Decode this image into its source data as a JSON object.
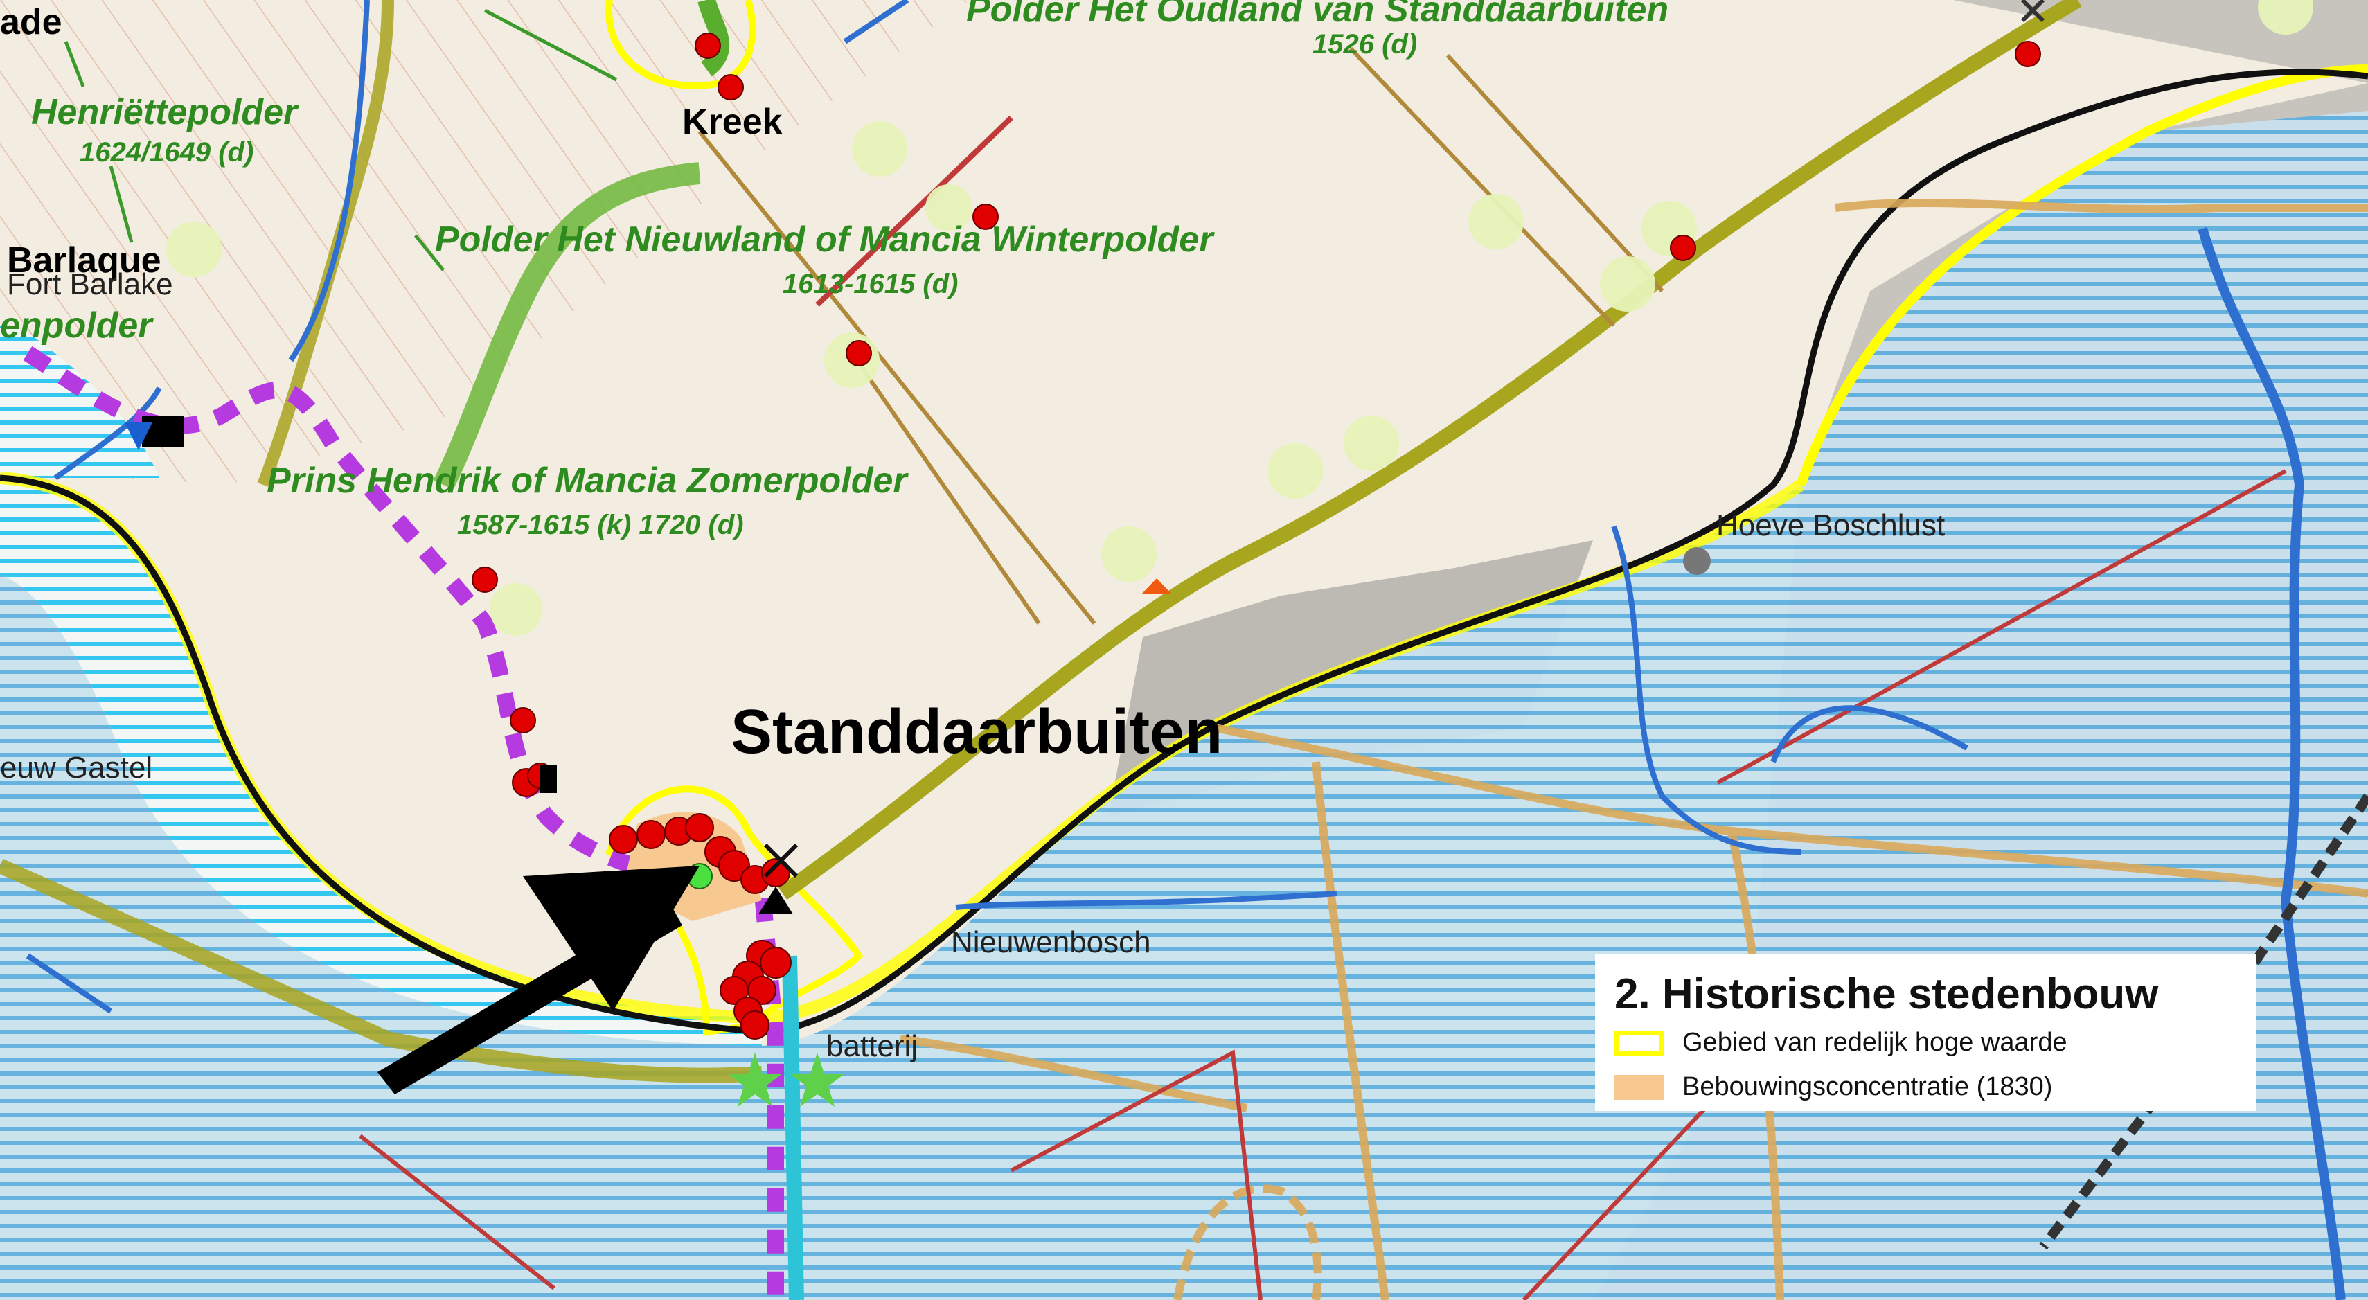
{
  "labels": {
    "polder_oudland": "Polder Het Oudland van Standdaarbuiten",
    "polder_oudland_date": "1526 (d)",
    "henriettepolder": "Henriëttepolder",
    "henriettepolder_date": "1624/1649 (d)",
    "kreek": "Kreek",
    "polder_nieuwland": "Polder Het Nieuwland of Mancia Winterpolder",
    "polder_nieuwland_date": "1613-1615 (d)",
    "barlaque": "Barlaque",
    "fort_barlake": "Fort Barlake",
    "enpolder": "enpolder",
    "ade": "ade",
    "prins_hendrik": "Prins Hendrik of Mancia Zomerpolder",
    "prins_hendrik_date": "1587-1615 (k) 1720 (d)",
    "hoeve_boschlust": "Hoeve Boschlust",
    "standdaarbuiten": "Standdaarbuiten",
    "euw_gastel": "euw Gastel",
    "nieuwenbosch": "Nieuwenbosch",
    "batterij": "batterij"
  },
  "legend": {
    "title": "2. Historische stedenbouw",
    "items": [
      {
        "label": "Gebied van redelijk hoge waarde",
        "swatch": "outline",
        "color": "#ffff00"
      },
      {
        "label": "Bebouwingsconcentratie (1830)",
        "swatch": "fill",
        "color": "#f7c88f"
      }
    ]
  },
  "colors": {
    "land": "#f3ece0",
    "water_hatch": "#5fb0e0",
    "water_hatch_bright": "#34c8f0",
    "polder_dike": "#a8a51e",
    "high_value_outline": "#ffff00",
    "settlement_1830": "#f7c88f",
    "road": "#d9a85a",
    "red_line": "#c03a3a",
    "blue_stream": "#2f6fd0",
    "purple_route": "#b53ae0",
    "dots": "#e00000",
    "urban_gray": "#bdbab4"
  }
}
